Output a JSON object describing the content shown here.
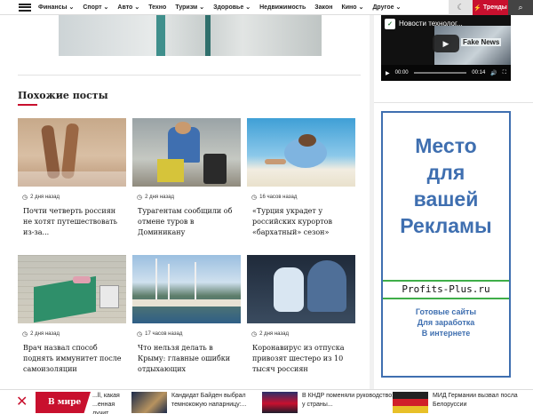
{
  "nav": {
    "items": [
      {
        "label": "Финансы",
        "chev": true
      },
      {
        "label": "Спорт",
        "chev": true
      },
      {
        "label": "Авто",
        "chev": true
      },
      {
        "label": "Техно",
        "chev": false
      },
      {
        "label": "Туризм",
        "chev": true
      },
      {
        "label": "Здоровье",
        "chev": true
      },
      {
        "label": "Недвижимость",
        "chev": false
      },
      {
        "label": "Закон",
        "chev": false
      },
      {
        "label": "Кино",
        "chev": true
      },
      {
        "label": "Другое",
        "chev": true
      }
    ],
    "trends_label": "Тренды",
    "moon_icon": "moon-icon",
    "search_icon": "search-icon"
  },
  "related": {
    "title": "Похожие посты",
    "cards": [
      {
        "meta": "2 дня назад",
        "title": "Почти четверть россиян не хотят путешествовать из-за..."
      },
      {
        "meta": "2 дня назад",
        "title": "Турагентам сообщили об отмене туров в Доминикану"
      },
      {
        "meta": "16 часов назад",
        "title": "«Турция украдет у российских курортов «бархатный» сезон»"
      },
      {
        "meta": "2 дня назад",
        "title": "Врач назвал способ поднять иммунитет после самоизоляции"
      },
      {
        "meta": "17 часов назад",
        "title": "Что нельзя делать в Крыму: главные ошибки отдыхающих"
      },
      {
        "meta": "2 дня назад",
        "title": "Коронавирус из отпуска привозят шестеро из 10 тысяч россиян"
      }
    ]
  },
  "video": {
    "title": "Новости технолог...",
    "current": "00:00",
    "duration": "00:14",
    "screen_text": "Fake News"
  },
  "ad": {
    "headline": [
      "Место",
      "для",
      "вашей",
      "Рекламы"
    ],
    "brand": "Profits-Plus.ru",
    "sub": [
      "Готовые сайты",
      "Для заработка",
      "В интернете"
    ]
  },
  "ticker": {
    "label": "В мире",
    "items": [
      "...ll, какая ...енная лучит гриф...",
      "Кандидат Байден выбрал темнокожую напарницу:...",
      "В КНДР поменяли руководство: у страны...",
      "МИД Германии вызвал посла Белоруссии"
    ]
  },
  "colors": {
    "accent": "#c8102e",
    "ad_blue": "#3f6fb0",
    "ad_green": "#3fae49"
  }
}
